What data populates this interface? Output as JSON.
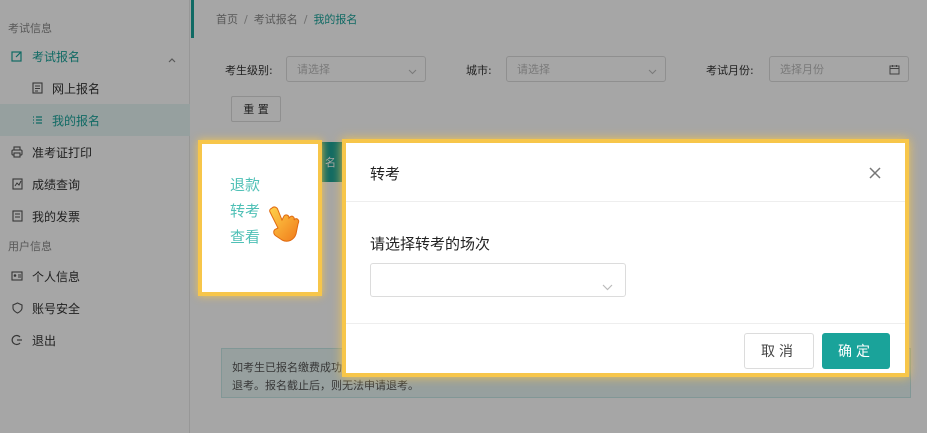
{
  "sidebar": {
    "group1_title": "考试信息",
    "exam_reg": "考试报名",
    "online_reg": "网上报名",
    "my_reg": "我的报名",
    "admission_print": "准考证打印",
    "score_query": "成绩查询",
    "my_invoice": "我的发票",
    "group2_title": "用户信息",
    "personal_info": "个人信息",
    "account_security": "账号安全",
    "logout": "退出"
  },
  "breadcrumb": {
    "home": "首页",
    "exam_reg": "考试报名",
    "current": "我的报名",
    "separator": "/"
  },
  "filters": {
    "level_label": "考生级别:",
    "level_placeholder": "请选择",
    "city_label": "城市:",
    "city_placeholder": "请选择",
    "month_label": "考试月份:",
    "month_placeholder": "选择月份",
    "reset_label": "重 置"
  },
  "table_button_fragment": "名",
  "notice": {
    "line1": "如考生已报名缴费成功",
    "line2": "退考。报名截止后，则无法申请退考。"
  },
  "actions": {
    "refund": "退款",
    "transfer": "转考",
    "view": "查看"
  },
  "dialog": {
    "title": "转考",
    "prompt": "请选择转考的场次",
    "select_value": "",
    "cancel_label": "取消",
    "ok_label": "确定"
  },
  "colors": {
    "accent": "#1aa39a",
    "highlight": "#f7c64a"
  }
}
